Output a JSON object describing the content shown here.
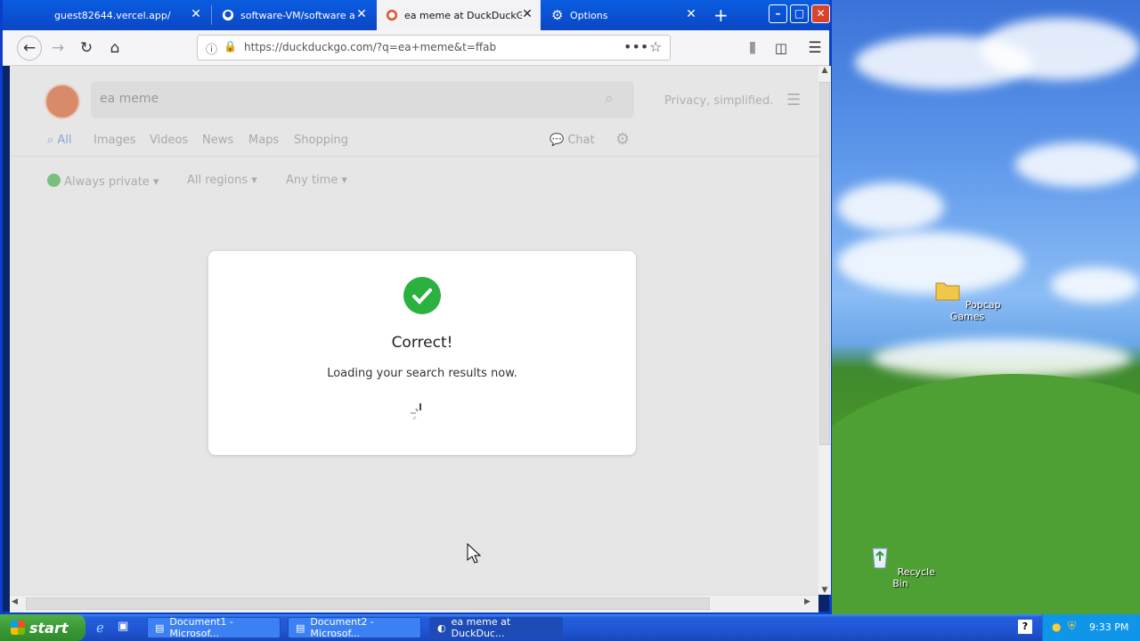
{
  "tabs": [
    {
      "title": "guest82644.vercel.app/",
      "icon": "blank-page-icon"
    },
    {
      "title": "software-VM/software at",
      "icon": "github-icon"
    },
    {
      "title": "ea meme at DuckDuckGo",
      "icon": "duckduckgo-icon"
    },
    {
      "title": "Options",
      "icon": "gear-icon"
    }
  ],
  "address": {
    "url": "https://duckduckgo.com/?q=ea+meme&t=ffab"
  },
  "ddg": {
    "query": "ea meme",
    "tagline": "Privacy, simplified.",
    "tabs": [
      "All",
      "Images",
      "Videos",
      "News",
      "Maps",
      "Shopping"
    ],
    "chat": "Chat",
    "filters": [
      "Always private",
      "All regions",
      "Any time"
    ]
  },
  "modal": {
    "title": "Correct!",
    "message": "Loading your search results now."
  },
  "desktop": {
    "icons": [
      "Popcap Games",
      "Recycle Bin"
    ]
  },
  "taskbar": {
    "start": "start",
    "tasks": [
      "Document1 - Microsof...",
      "Document2 - Microsof...",
      "ea meme at DuckDuc..."
    ],
    "clock": "9:33 PM"
  },
  "colors": {
    "accent": "#2bb13f",
    "ddg_blue": "#5b8bd8",
    "xp_blue": "#245edb"
  }
}
